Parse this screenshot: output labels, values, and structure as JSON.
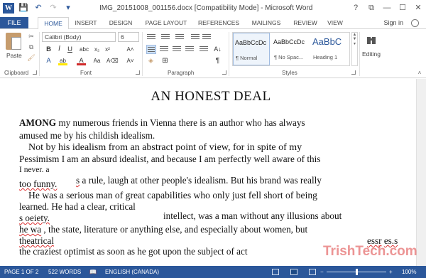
{
  "app": {
    "logo_letter": "W",
    "title": "IMG_20151008_001156.docx [Compatibility Mode] - Microsoft Word",
    "window_controls": [
      "?",
      "⧉",
      "—",
      "☐",
      "✕"
    ]
  },
  "qat": {
    "save": "💾",
    "undo": "↶",
    "redo": "↷",
    "customize": "▾"
  },
  "tabs": {
    "file": "FILE",
    "items": [
      "HOME",
      "INSERT",
      "DESIGN",
      "PAGE LAYOUT",
      "REFERENCES",
      "MAILINGS",
      "REVIEW",
      "VIEW"
    ],
    "active": "HOME",
    "signin": "Sign in"
  },
  "ribbon": {
    "clipboard": {
      "paste": "Paste",
      "label": "Clipboard"
    },
    "font": {
      "name": "Calibri (Body)",
      "size": "6",
      "label": "Font"
    },
    "paragraph": {
      "label": "Paragraph"
    },
    "styles": {
      "label": "Styles",
      "items": [
        {
          "sample": "AaBbCcDc",
          "name": "¶ Normal"
        },
        {
          "sample": "AaBbCcDc",
          "name": "¶ No Spac..."
        },
        {
          "sample": "AaBbC",
          "name": "Heading 1"
        }
      ]
    },
    "editing": {
      "label": "Editing"
    }
  },
  "document": {
    "heading": "AN HONEST DEAL",
    "lines": {
      "l1a": "AMONG",
      "l1b": " my numerous friends in Vienna there is an author who has always",
      "l2": "amused me by his childish idealism.",
      "l3": "Not by his idealism from an abstract point of view, for in spite of my",
      "l4": "Pessimism I am an absurd idealist, and because I am perfectly well aware of this",
      "l5": "I never. a",
      "l6a": "too funny.",
      "l6b": "s",
      "l6c": " a rule, laugh at other people's idealism. But his brand was really",
      "l7": "He was a serious man of great capabilities who only just fell short of being",
      "l8": "learned. He had a clear, critical",
      "l9a": "s  oeiety.",
      "l9b": "intellect, was a man without any illusions about",
      "l10a": "he wa",
      "l10b": " , the state, literature  or anything else, and especially  about women, but",
      "l11a": "theatrical",
      "l11b": "essr",
      "l11c": "es.s",
      "l12": "the craziest optimist as soon as he got upon the subject of act"
    }
  },
  "watermark": "TrishTech.com",
  "status": {
    "page": "PAGE 1 OF 2",
    "words": "522 WORDS",
    "language": "ENGLISH (CANADA)",
    "zoom_minus": "−",
    "zoom_plus": "+",
    "zoom": "100%",
    "zoom_level": 0.5
  },
  "colors": {
    "accent": "#2b579a",
    "spell_error": "#dd3333",
    "watermark": "#dc3c3c"
  }
}
